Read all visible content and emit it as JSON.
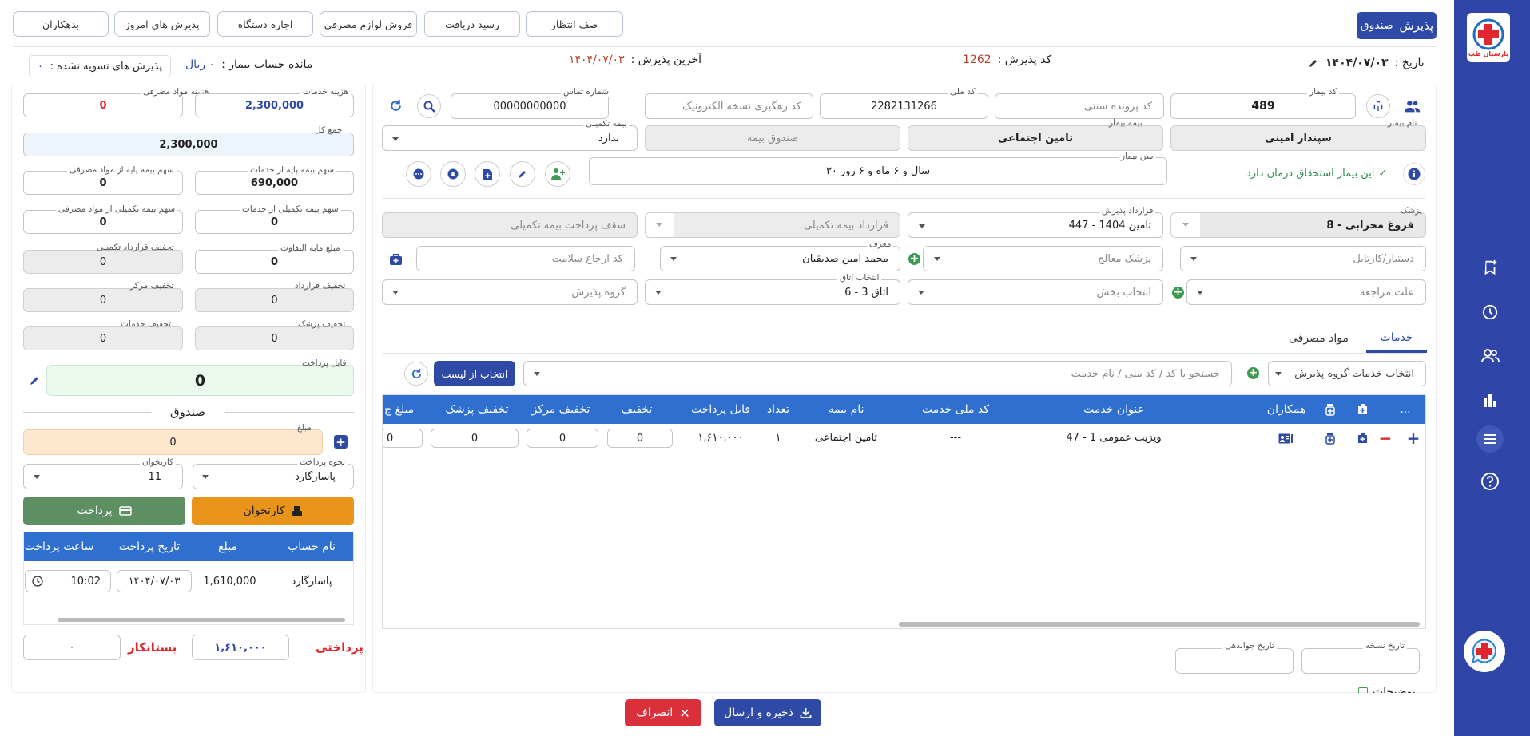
{
  "toolbar": {
    "debtors": "بدهکاران",
    "today_admissions": "پذیرش های امروز",
    "device_rent": "اجاره دستگاه",
    "consumables_sale": "فروش لوازم مصرفی",
    "receipt": "رسید دریافت",
    "queue": "صف انتظار",
    "tab_fund": "صندوق",
    "tab_admission": "پذیرش"
  },
  "info": {
    "unsettled_label": "پذیرش های تسویه نشده :",
    "unsettled_value": "۰",
    "balance_label": "مانده حساب بیمار :",
    "balance_value": "۰ ریال",
    "last_adm_label": "آخرین پذیرش :",
    "last_adm_value": "۱۴۰۴/۰۷/۰۳",
    "adm_code_label": "کد پذیرش :",
    "adm_code_value": "1262",
    "date_label": "تاریخ :",
    "date_value": "۱۴۰۴/۰۷/۰۳"
  },
  "patient": {
    "code_label": "کد بیمار",
    "code": "489",
    "trad_file_ph": "کد پرونده سنتی",
    "nid_label": "کد ملی",
    "nid": "2282131266",
    "epres_ph": "کد رهگیری نسخه الکترونیک",
    "phone_label": "شماره تماس",
    "phone": "00000000000",
    "name_label": "نام بیمار",
    "name": "سپندار امینی",
    "ins_label": "بیمه بیمار",
    "ins": "تامین اجتماعی",
    "fund_ph": "صندوق بیمه",
    "sup_label": "بیمه تکمیلی",
    "sup": "ندارد",
    "age_label": "سن بیمار",
    "age": "۳۰ سال و ۶ ماه و ۶ روز",
    "eligible": "این بیمار استحقاق درمان دارد"
  },
  "adm": {
    "doctor_label": "پزشک",
    "doctor": "8 - فروغ محرابی",
    "contract_label": "قرارداد پذیرش",
    "contract": "447 - تامین 1404",
    "sup_contract_ph": "قرارداد بیمه تکمیلی",
    "sup_cap_ph": "سقف پرداخت بیمه تکمیلی",
    "assistant_ph": "دستیار/کارتابل",
    "treating_ph": "پزشک معالج",
    "ref_label": "معرف",
    "ref": "محمد امین صدیقیان",
    "salamat_ph": "کد ارجاع سلامت",
    "reason_ph": "علت مراجعه",
    "dept_ph": "انتخاب بخش",
    "room_label": "انتخاب اتاق",
    "room": "6 - اتاق 3",
    "group_ph": "گروه پذیرش"
  },
  "tabs": {
    "services": "خدمات",
    "consumables": "مواد مصرفی"
  },
  "svc": {
    "group_ph": "انتخاب خدمات گروه پذیرش",
    "search_ph": "جستجو با کد / کد ملی / نام خدمت",
    "select_list": "انتخاب از لیست"
  },
  "table": {
    "headers": [
      "...",
      "همکاران",
      "عنوان خدمت",
      "کد ملی خدمت",
      "نام بیمه",
      "تعداد",
      "قابل پرداخت",
      "تخفیف",
      "تخفیف مرکز",
      "تخفیف پزشک",
      "مبلغ ج"
    ],
    "row": {
      "title": "47 - ویزیت عمومی 1",
      "nid": "---",
      "ins": "تامین اجتماعی",
      "count": "۱",
      "payable": "۱,۶۱۰,۰۰۰",
      "disc": "0",
      "disc_center": "0",
      "disc_doc": "0",
      "amount": "0"
    }
  },
  "bottom": {
    "pres_date": "تاریخ نسخه",
    "answer_date": "تاریخ جوابدهی",
    "desc_partial": "توضیحات"
  },
  "fin": {
    "svc_cost_label": "هزینه خدمات",
    "svc_cost": "2,300,000",
    "cons_cost_label": "هزینه مواد مصرفی",
    "cons_cost": "0",
    "total_label": "جمع کل",
    "total": "2,300,000",
    "base_svc_label": "سهم بیمه پایه از خدمات",
    "base_svc": "690,000",
    "base_cons_label": "سهم بیمه پایه از مواد مصرفی",
    "base_cons": "0",
    "sup_svc_label": "سهم بیمه تکمیلی از خدمات",
    "sup_svc": "0",
    "sup_cons_label": "سهم بیمه تکمیلی از مواد مصرفی",
    "sup_cons": "0",
    "diff_label": "مبلغ مابه التفاوت",
    "diff": "0",
    "sup_contract_disc_label": "تخفیف قرارداد تکمیلی",
    "sup_contract_disc": "0",
    "contract_disc_label": "تخفیف قرارداد",
    "contract_disc": "0",
    "center_disc_label": "تخفیف مرکز",
    "center_disc": "0",
    "doc_disc_label": "تخفیف پزشک",
    "doc_disc": "0",
    "svc_disc_label": "تخفیف خدمات",
    "svc_disc": "0",
    "payable_label": "قابل پرداخت",
    "payable": "0"
  },
  "fund": {
    "title": "صندوق",
    "amount_label": "مبلغ",
    "amount": "0",
    "method_label": "نحوه پرداخت",
    "method": "پاسارگارد",
    "reader_label": "کارتخوان",
    "reader": "11",
    "pay_btn": "پرداخت",
    "reader_btn": "کارتخوان"
  },
  "payments": {
    "headers": [
      "نام حساب",
      "مبلغ",
      "تاریخ پرداخت",
      "ساعت پرداخت"
    ],
    "row": {
      "account": "پاسارگارد",
      "amount": "1,610,000",
      "date": "۱۴۰۴/۰۷/۰۳",
      "time": "10:02"
    }
  },
  "summary": {
    "paid_label": "پرداختی",
    "paid": "۱,۶۱۰,۰۰۰",
    "creditor_label": "بستانکار",
    "creditor": "۰"
  },
  "footer": {
    "save": "ذخیره و ارسال",
    "cancel": "انصراف"
  },
  "logo": {
    "text": "پارسیان طب"
  },
  "colors": {
    "primary": "#2f4aa6",
    "sidebar": "#2f45a8",
    "green": "#5d8f63",
    "orange": "#e8931a",
    "red": "#d9303c"
  }
}
